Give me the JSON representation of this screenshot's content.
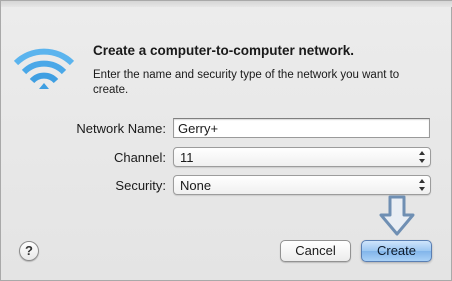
{
  "dialog": {
    "heading": "Create a computer-to-computer network.",
    "subtitle": "Enter the name and security type of the network you want to create.",
    "icon": "wifi-icon"
  },
  "form": {
    "network_name_label": "Network Name:",
    "network_name_value": "Gerry+",
    "channel_label": "Channel:",
    "channel_value": "11",
    "security_label": "Security:",
    "security_value": "None"
  },
  "buttons": {
    "help_label": "?",
    "cancel_label": "Cancel",
    "create_label": "Create"
  },
  "annotation": {
    "arrow_color": "#6f8fb3"
  },
  "colors": {
    "wifi_blue": "#4aa8e8",
    "default_button": "#9cc7f2"
  }
}
